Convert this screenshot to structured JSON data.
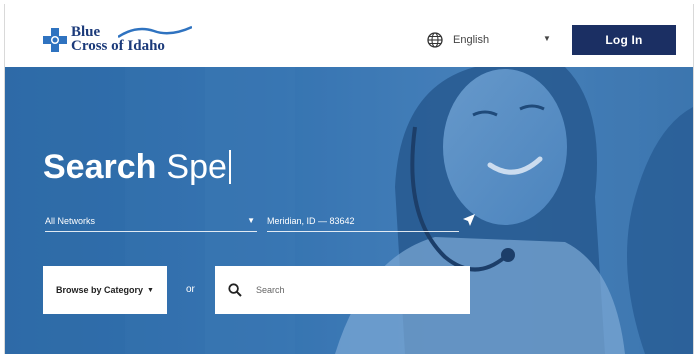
{
  "header": {
    "logo": {
      "line1": "Blue",
      "line2": "Cross of Idaho"
    },
    "language": {
      "label": "English",
      "icon": "globe-icon"
    },
    "login_label": "Log In"
  },
  "hero": {
    "title_bold": "Search",
    "title_typed": "Spe",
    "network": {
      "value": "All Networks"
    },
    "location": {
      "value": "Meridian, ID — 83642",
      "icon": "location-arrow-icon"
    },
    "browse_label": "Browse by Category",
    "or_label": "or",
    "search": {
      "placeholder": "Search",
      "icon": "search-icon"
    }
  },
  "colors": {
    "brand_navy": "#1b2f63",
    "logo_blue": "#1b3a7a",
    "hero_blue": "#3776b4"
  }
}
